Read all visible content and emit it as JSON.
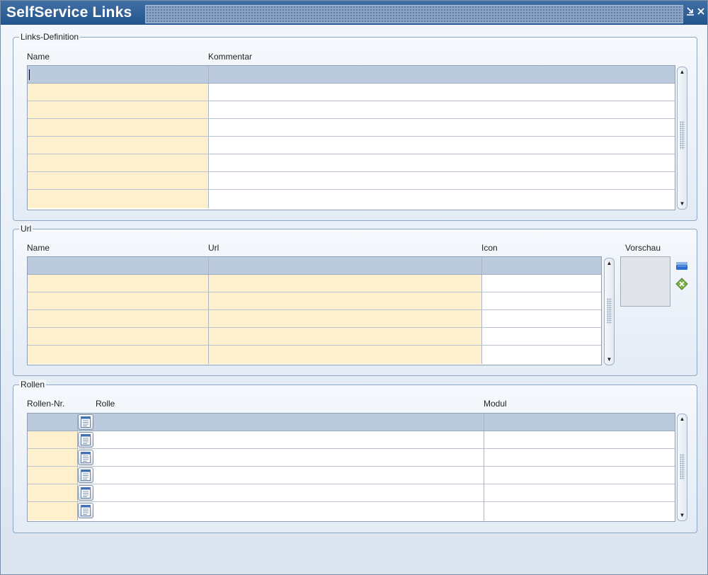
{
  "window": {
    "title": "SelfService Links",
    "minimize_icon": "minimize-arrow-icon",
    "close_icon": "close-icon",
    "title_color": "#2a5b93"
  },
  "links_definition": {
    "legend": "Links-Definition",
    "columns": {
      "name": "Name",
      "kommentar": "Kommentar"
    },
    "empty_rows": 7
  },
  "url": {
    "legend": "Url",
    "columns": {
      "name": "Name",
      "url": "Url",
      "icon": "Icon"
    },
    "preview_label": "Vorschau",
    "empty_rows": 5,
    "side_icons": [
      "folder-open-icon",
      "clear-image-icon"
    ]
  },
  "rollen": {
    "legend": "Rollen",
    "columns": {
      "rollen_nr": "Rollen-Nr.",
      "rolle": "Rolle",
      "modul": "Modul"
    },
    "empty_rows": 5,
    "lov_icon": "list-of-values-icon"
  },
  "colors": {
    "required_field": "#fff0cd",
    "grid_header": "#bccadd",
    "title_bar": "#2a5b93"
  }
}
